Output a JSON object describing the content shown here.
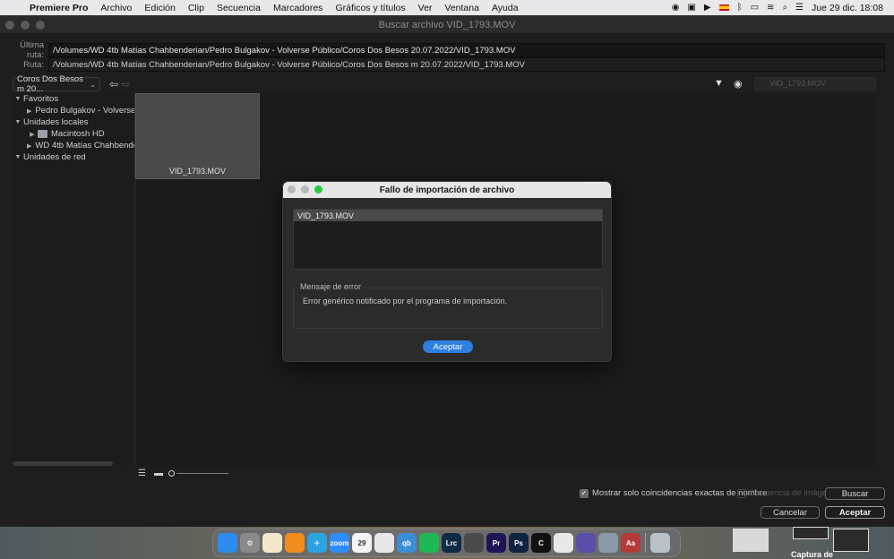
{
  "menubar": {
    "app_name": "Premiere Pro",
    "items": [
      "Archivo",
      "Edición",
      "Clip",
      "Secuencia",
      "Marcadores",
      "Gráficos y títulos",
      "Ver",
      "Ventana",
      "Ayuda"
    ],
    "clock": "Jue 29 dic.  18:08"
  },
  "window": {
    "title": "Buscar archivo VID_1793.MOV",
    "last_path_label": "Última ruta:",
    "last_path_value": "/Volumes/WD 4tb Matías Chahbenderian/Pedro Bulgakov - Volverse Público/Coros Dos Besos 20.07.2022/VID_1793.MOV",
    "path_label": "Ruta:",
    "path_value": "/Volumes/WD 4tb Matías Chahbenderian/Pedro Bulgakov - Volverse Público/Coros Dos Besos m 20.07.2022/VID_1793.MOV",
    "location_select": "Coros Dos Besos m 20...",
    "search_placeholder": "VID_1793.MOV"
  },
  "sidebar": {
    "favorites_label": "Favoritos",
    "favorites": [
      "Pedro Bulgakov - Volverse"
    ],
    "local_label": "Unidades locales",
    "local": [
      "Macintosh HD",
      "WD 4tb Matías Chahbende"
    ],
    "network_label": "Unidades de red"
  },
  "browser": {
    "thumbnail_name": "VID_1793.MOV"
  },
  "options": {
    "exact_match_label": "Mostrar solo coincidencias exactas de nombre",
    "image_sequence_label": "Secuencia de imágenes",
    "search_button": "Buscar",
    "cancel_button": "Cancelar",
    "accept_button": "Aceptar"
  },
  "dialog": {
    "title": "Fallo de importación de archivo",
    "file_item": "VID_1793.MOV",
    "error_group_label": "Mensaje de error",
    "error_message": "Error genérico notificado por el programa de importación.",
    "ok_button": "Aceptar"
  },
  "dock": {
    "items": [
      {
        "name": "finder",
        "label": "",
        "color": "#2c8cf0"
      },
      {
        "name": "system-settings",
        "label": "⚙",
        "color": "#8a8a8a"
      },
      {
        "name": "textedit",
        "label": "",
        "color": "#f2e7c8"
      },
      {
        "name": "vlc",
        "label": "",
        "color": "#f28c1c"
      },
      {
        "name": "telegram",
        "label": "✈",
        "color": "#2aa3e0"
      },
      {
        "name": "zoom",
        "label": "zoom",
        "color": "#2d8cff"
      },
      {
        "name": "calendar",
        "label": "29",
        "color": "#f4f4f4"
      },
      {
        "name": "chrome",
        "label": "",
        "color": "#e8e8e8"
      },
      {
        "name": "qbittorrent",
        "label": "qb",
        "color": "#3c8ed4"
      },
      {
        "name": "spotify",
        "label": "",
        "color": "#1db954"
      },
      {
        "name": "lightroom",
        "label": "Lrc",
        "color": "#0f2c46"
      },
      {
        "name": "calculator",
        "label": "",
        "color": "#4a4a4a"
      },
      {
        "name": "premiere",
        "label": "Pr",
        "color": "#1e1456"
      },
      {
        "name": "photoshop",
        "label": "Ps",
        "color": "#0f2440"
      },
      {
        "name": "c-app",
        "label": "C",
        "color": "#111111"
      },
      {
        "name": "preview",
        "label": "",
        "color": "#e8e8e8"
      },
      {
        "name": "vpn",
        "label": "",
        "color": "#5a4fa8"
      },
      {
        "name": "quicktime",
        "label": "",
        "color": "#8a9aaa"
      },
      {
        "name": "dictionary",
        "label": "Aa",
        "color": "#b53a3a"
      },
      {
        "name": "trash",
        "label": "",
        "color": "#b8c0c8"
      }
    ]
  },
  "desktop": {
    "screenshot_label": "Captura de"
  }
}
